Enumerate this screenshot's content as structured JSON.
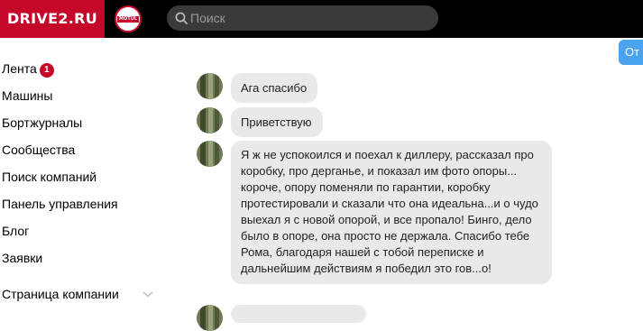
{
  "header": {
    "logo": "DRIVE2.RU",
    "badge_text": "MOTUL",
    "search_placeholder": "Поиск",
    "right_button": "От"
  },
  "sidebar": {
    "items": [
      {
        "label": "Лента",
        "count": "1"
      },
      {
        "label": "Машины"
      },
      {
        "label": "Бортжурналы"
      },
      {
        "label": "Сообщества"
      },
      {
        "label": "Поиск компаний"
      },
      {
        "label": "Панель управления"
      },
      {
        "label": "Блог"
      },
      {
        "label": "Заявки"
      },
      {
        "label": "Страница компании"
      }
    ]
  },
  "messages": [
    {
      "text": "Ага спасибо"
    },
    {
      "text": "Приветствую"
    },
    {
      "text": "Я ж не успокоился и поехал к диллеру, рассказал про коробку, про дерганье, и показал им фото опоры... короче, опору поменяли по гарантии, коробку протестировали и сказали что она идеальна...и о чудо выехал я с новой опорой, и все пропало! Бинго, дело было в опоре, она просто не держала. Спасибо тебе Рома, благодаря нашей с тобой переписке и дальнейшим действиям я победил это гов...о!"
    }
  ],
  "colors": {
    "brand": "#c5082a",
    "accent": "#4aa3ef",
    "bubble": "#e9e9e9"
  }
}
